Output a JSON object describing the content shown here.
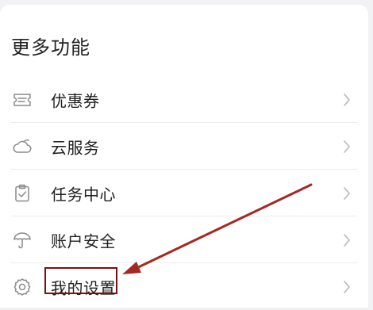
{
  "section": {
    "title": "更多功能"
  },
  "menu": {
    "items": [
      {
        "label": "优惠券",
        "icon": "coupon-icon"
      },
      {
        "label": "云服务",
        "icon": "cloud-icon"
      },
      {
        "label": "任务中心",
        "icon": "task-clipboard-icon"
      },
      {
        "label": "账户安全",
        "icon": "umbrella-icon"
      },
      {
        "label": "我的设置",
        "icon": "gear-icon"
      }
    ]
  },
  "colors": {
    "background": "#f2f2f4",
    "card": "#ffffff",
    "text": "#1f1f1f",
    "icon": "#8a8a8a",
    "chevron": "#b8b8b8",
    "annotation": "#a32a22",
    "highlight_border": "#7a1010"
  }
}
